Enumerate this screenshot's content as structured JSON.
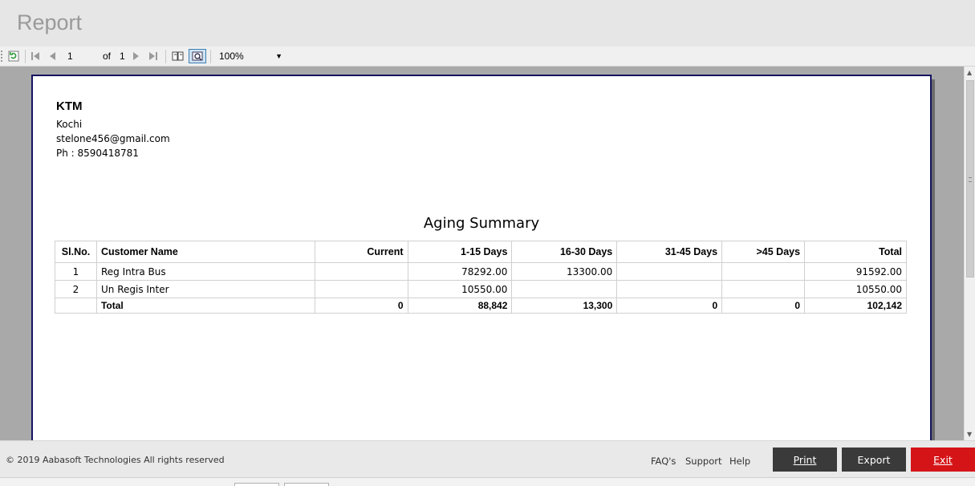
{
  "window": {
    "title": "Report"
  },
  "toolbar": {
    "refresh_icon": "refresh-icon",
    "current_page": "1",
    "of_label": "of",
    "total_pages": "1",
    "zoom": "100%"
  },
  "report": {
    "company": "KTM",
    "city": "Kochi",
    "email": "stelone456@gmail.com",
    "phone": "Ph : 8590418781",
    "title": "Aging Summary",
    "columns": [
      "Sl.No.",
      "Customer Name",
      "Current",
      "1-15 Days",
      "16-30 Days",
      "31-45 Days",
      ">45 Days",
      "Total"
    ],
    "rows": [
      {
        "sl": "1",
        "name": "Reg Intra Bus",
        "current": "",
        "d1_15": "78292.00",
        "d16_30": "13300.00",
        "d31_45": "",
        "d45": "",
        "total": "91592.00"
      },
      {
        "sl": "2",
        "name": "Un Regis Inter",
        "current": "",
        "d1_15": "10550.00",
        "d16_30": "",
        "d31_45": "",
        "d45": "",
        "total": "10550.00"
      }
    ],
    "totals": {
      "label": "Total",
      "current": "0",
      "d1_15": "88,842",
      "d16_30": "13,300",
      "d31_45": "0",
      "d45": "0",
      "total": "102,142"
    }
  },
  "footer": {
    "copyright": "© 2019 Aabasoft Technologies All rights reserved",
    "links": [
      "FAQ's",
      "Support",
      "Help"
    ],
    "print_label": "Print",
    "export_label": "Export",
    "exit_label": "Exit"
  },
  "colors": {
    "exit": "#d51418",
    "button_dark": "#3a3a3a",
    "page_border": "#15135f"
  }
}
